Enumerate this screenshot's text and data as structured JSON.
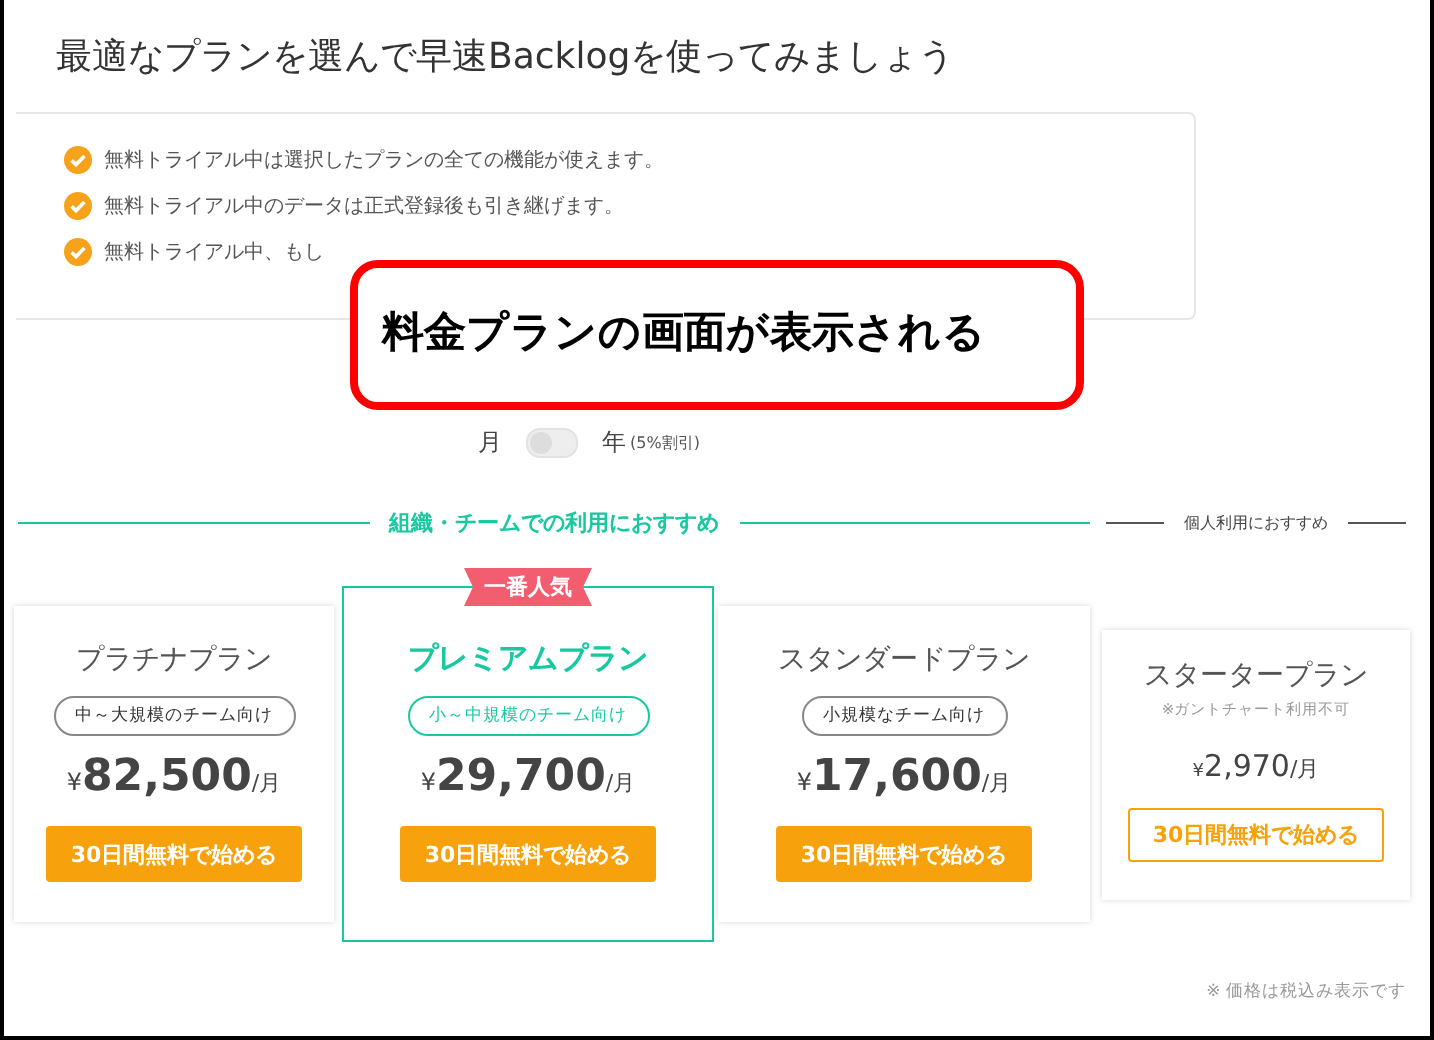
{
  "heading": "最適なプランを選んで早速Backlogを使ってみましょう",
  "benefits": [
    "無料トライアル中は選択したプランの全ての機能が使えます。",
    "無料トライアル中のデータは正式登録後も引き継げます。",
    "無料トライアル中、もし"
  ],
  "callout": {
    "text": "料金プランの画面が表示される"
  },
  "billing_toggle": {
    "monthly_label": "月",
    "yearly_label": "年",
    "discount_note": "(5%割引)",
    "on": false
  },
  "sections": [
    {
      "label": "組織・チームでの利用におすすめ",
      "kind": "primary"
    },
    {
      "label": "個人利用におすすめ",
      "kind": "secondary"
    }
  ],
  "plans": [
    {
      "kind": "team",
      "featured": false,
      "name": "プラチナプラン",
      "audience": "中～大規模のチーム向け",
      "currency": "¥",
      "price": "82,500",
      "unit": "/月",
      "button": "30日間無料で始める"
    },
    {
      "kind": "team",
      "featured": true,
      "ribbon": "一番人気",
      "name": "プレミアムプラン",
      "audience": "小～中規模のチーム向け",
      "currency": "¥",
      "price": "29,700",
      "unit": "/月",
      "button": "30日間無料で始める"
    },
    {
      "kind": "team",
      "featured": false,
      "name": "スタンダードプラン",
      "audience": "小規模なチーム向け",
      "currency": "¥",
      "price": "17,600",
      "unit": "/月",
      "button": "30日間無料で始める"
    },
    {
      "kind": "personal",
      "featured": false,
      "name": "スタータープラン",
      "note": "※ガントチャート利用不可",
      "currency": "¥",
      "price": "2,970",
      "unit": "/月",
      "button": "30日間無料で始める"
    }
  ],
  "footnote": "※ 価格は税込み表示です"
}
